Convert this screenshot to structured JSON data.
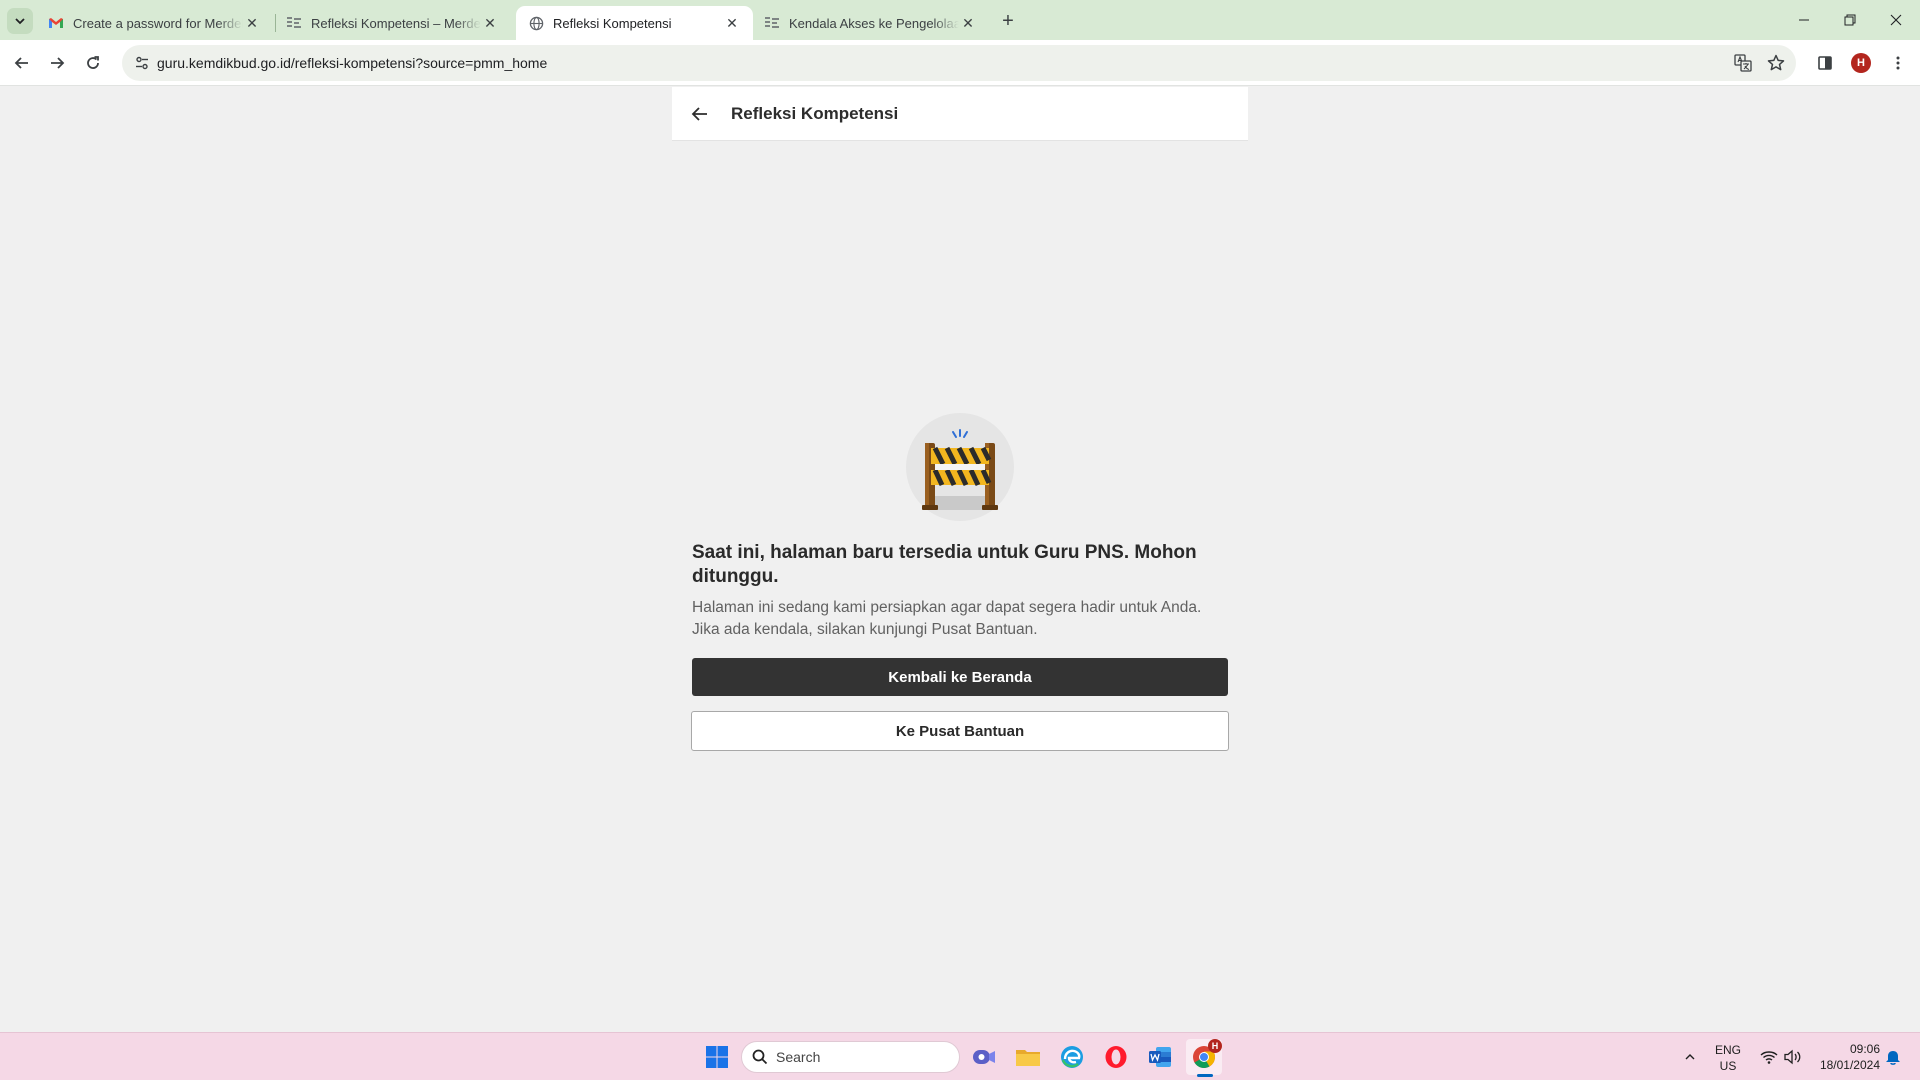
{
  "browser": {
    "tabs": [
      {
        "title": "Create a password for Merdeka",
        "favicon": "gmail-icon",
        "active": false
      },
      {
        "title": "Refleksi Kompetensi – Merdeka",
        "favicon": "site-icon",
        "active": false
      },
      {
        "title": "Refleksi Kompetensi",
        "favicon": "globe-icon",
        "active": true
      },
      {
        "title": "Kendala Akses ke Pengelolaan",
        "favicon": "site-icon",
        "active": false
      }
    ],
    "url": "guru.kemdikbud.go.id/refleksi-kompetensi?source=pmm_home",
    "profile_initial": "H",
    "colors": {
      "tabstrip": "#d8ead4",
      "avatar": "#b3261e"
    }
  },
  "page": {
    "header_title": "Refleksi Kompetensi",
    "illustration": "road-barrier-icon",
    "heading": "Saat ini, halaman baru tersedia untuk Guru PNS. Mohon ditunggu.",
    "description": "Halaman ini sedang kami persiapkan agar dapat segera hadir untuk Anda. Jika ada kendala, silakan kunjungi Pusat Bantuan.",
    "primary_button": "Kembali ke Beranda",
    "secondary_button": "Ke Pusat Bantuan",
    "colors": {
      "primary_button": "#333333",
      "background": "#f0f0f0"
    }
  },
  "taskbar": {
    "search_placeholder": "Search",
    "language": "ENG",
    "region": "US",
    "time": "09:06",
    "date": "18/01/2024",
    "chrome_badge": "H",
    "colors": {
      "background": "#f5d8e6"
    }
  }
}
